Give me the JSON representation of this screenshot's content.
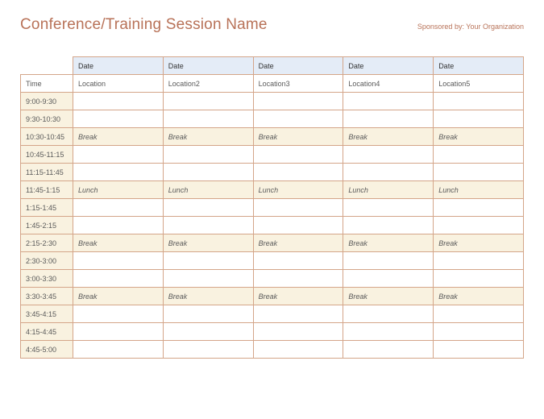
{
  "header": {
    "title": "Conference/Training Session Name",
    "sponsor": "Sponsored by: Your Organization"
  },
  "columns": {
    "time_label": "Time",
    "dates": [
      "Date",
      "Date",
      "Date",
      "Date",
      "Date"
    ],
    "locations": [
      "Location",
      "Location2",
      "Location3",
      "Location4",
      "Location5"
    ]
  },
  "rows": [
    {
      "time": "9:00-9:30",
      "cells": [
        "",
        "",
        "",
        "",
        ""
      ],
      "hl": false
    },
    {
      "time": "9:30-10:30",
      "cells": [
        "",
        "",
        "",
        "",
        ""
      ],
      "hl": false
    },
    {
      "time": "10:30-10:45",
      "cells": [
        "Break",
        "Break",
        "Break",
        "Break",
        "Break"
      ],
      "hl": true
    },
    {
      "time": "10:45-11:15",
      "cells": [
        "",
        "",
        "",
        "",
        ""
      ],
      "hl": false
    },
    {
      "time": "11:15-11:45",
      "cells": [
        "",
        "",
        "",
        "",
        ""
      ],
      "hl": false
    },
    {
      "time": "11:45-1:15",
      "cells": [
        "Lunch",
        "Lunch",
        "Lunch",
        "Lunch",
        "Lunch"
      ],
      "hl": true
    },
    {
      "time": "1:15-1:45",
      "cells": [
        "",
        "",
        "",
        "",
        ""
      ],
      "hl": false
    },
    {
      "time": "1:45-2:15",
      "cells": [
        "",
        "",
        "",
        "",
        ""
      ],
      "hl": false
    },
    {
      "time": "2:15-2:30",
      "cells": [
        "Break",
        "Break",
        "Break",
        "Break",
        "Break"
      ],
      "hl": true
    },
    {
      "time": "2:30-3:00",
      "cells": [
        "",
        "",
        "",
        "",
        ""
      ],
      "hl": false
    },
    {
      "time": "3:00-3:30",
      "cells": [
        "",
        "",
        "",
        "",
        ""
      ],
      "hl": false
    },
    {
      "time": "3:30-3:45",
      "cells": [
        "Break",
        "Break",
        "Break",
        "Break",
        "Break"
      ],
      "hl": true
    },
    {
      "time": "3:45-4:15",
      "cells": [
        "",
        "",
        "",
        "",
        ""
      ],
      "hl": false
    },
    {
      "time": "4:15-4:45",
      "cells": [
        "",
        "",
        "",
        "",
        ""
      ],
      "hl": false
    },
    {
      "time": "4:45-5:00",
      "cells": [
        "",
        "",
        "",
        "",
        ""
      ],
      "hl": false
    }
  ]
}
